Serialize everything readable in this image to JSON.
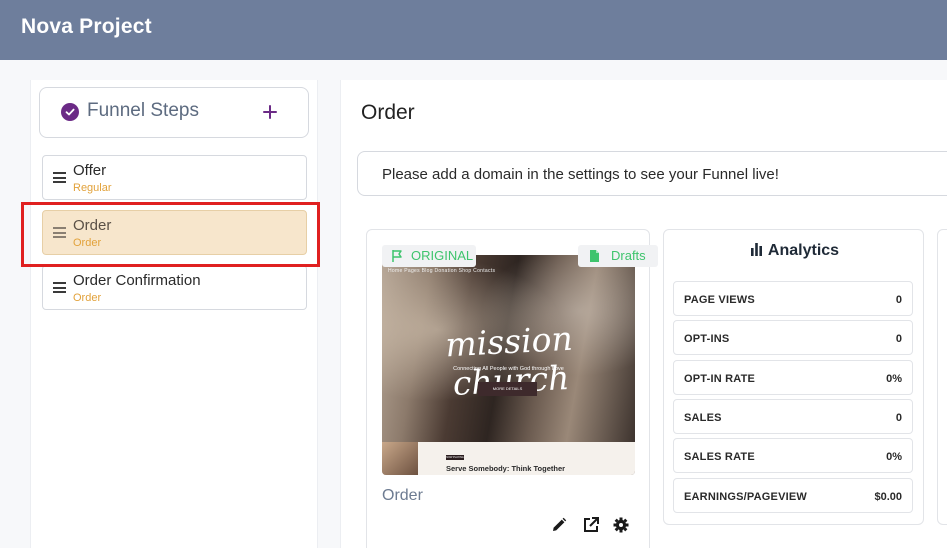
{
  "app": {
    "title": "Nova Project"
  },
  "sidebar": {
    "header": {
      "title": "Funnel Steps",
      "add_icon": "plus-icon",
      "status_icon": "check-circle-icon"
    },
    "steps": [
      {
        "name": "Offer",
        "type": "Regular",
        "active": false
      },
      {
        "name": "Order",
        "type": "Order",
        "active": true
      },
      {
        "name": "Order Confirmation",
        "type": "Order",
        "active": false
      }
    ]
  },
  "main": {
    "title": "Order",
    "notice": "Please add a domain in the settings to see your Funnel live!",
    "page_card": {
      "tag_original": "ORIGINAL",
      "tag_drafts": "Drafts",
      "name": "Order",
      "preview": {
        "nav": "Home    Pages    Blog    Donation    Shop    Contacts",
        "script_title": "mission church",
        "tagline": "Connecting All People with God through Love",
        "button": "MORE DETAILS",
        "badge": "NOW PLAYING",
        "headline": "Serve Somebody: Think Together"
      },
      "actions": [
        "pencil-icon",
        "external-link-icon",
        "gear-icon"
      ]
    },
    "analytics": {
      "title": "Analytics",
      "metrics": [
        {
          "label": "PAGE VIEWS",
          "value": "0"
        },
        {
          "label": "OPT-INS",
          "value": "0"
        },
        {
          "label": "OPT-IN RATE",
          "value": "0%"
        },
        {
          "label": "SALES",
          "value": "0"
        },
        {
          "label": "SALES RATE",
          "value": "0%"
        },
        {
          "label": "EARNINGS/PAGEVIEW",
          "value": "$0.00"
        }
      ]
    }
  },
  "colors": {
    "topbar": "#6e7e9c",
    "accent_purple": "#6b2a86",
    "tag_green": "#3ec46d",
    "step_sub": "#e2a23b",
    "active_step_bg": "#f7e6cc",
    "highlight_red": "#e02020"
  }
}
